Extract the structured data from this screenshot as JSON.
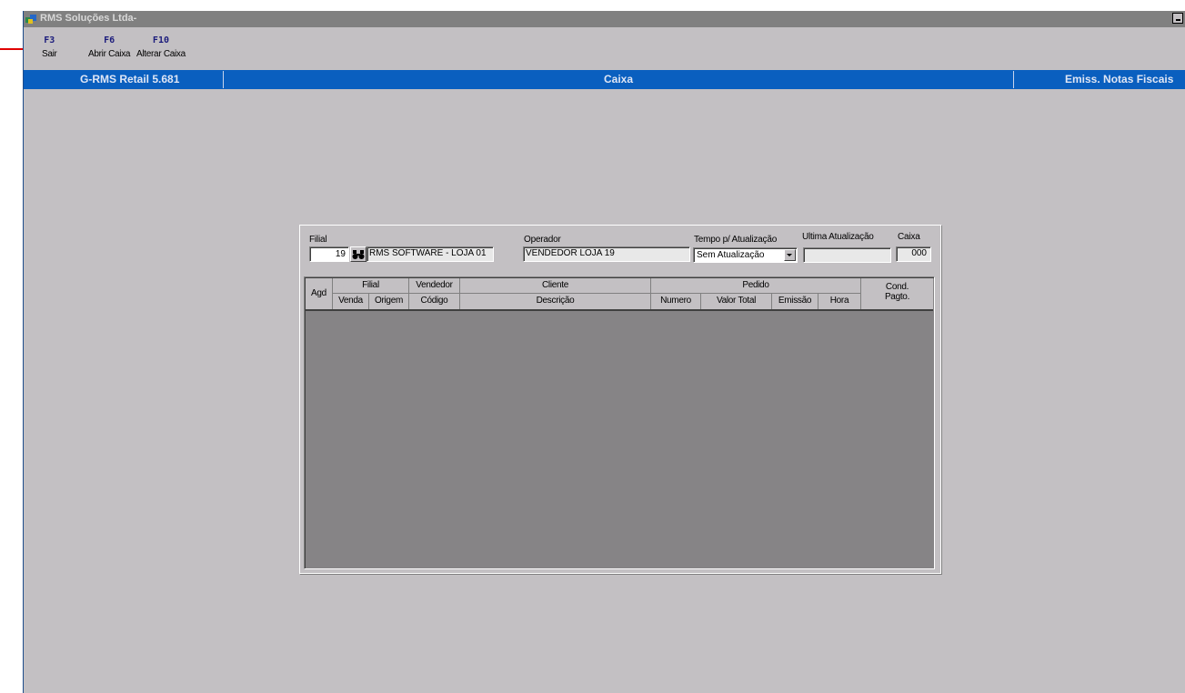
{
  "window": {
    "title": "RMS Soluções Ltda-"
  },
  "fkeys": [
    {
      "key": "F3",
      "label": "Sair"
    },
    {
      "key": "F6",
      "label": "Abrir Caixa"
    },
    {
      "key": "F10",
      "label": "Alterar Caixa"
    }
  ],
  "bluebar": {
    "left": "G-RMS Retail 5.681",
    "center": "Caixa",
    "right": "Emiss. Notas Fiscais"
  },
  "form": {
    "filial_label": "Filial",
    "filial_code": "19",
    "filial_name": "RMS SOFTWARE - LOJA 01",
    "operador_label": "Operador",
    "operador_value": "VENDEDOR LOJA 19",
    "tempo_label": "Tempo p/ Atualização",
    "tempo_value": "Sem Atualização",
    "ultima_label": "Ultima Atualização",
    "ultima_value": "",
    "caixa_label": "Caixa",
    "caixa_value": "000"
  },
  "grid": {
    "agd": "Agd",
    "filial": "Filial",
    "venda": "Venda",
    "origem": "Origem",
    "vendedor": "Vendedor",
    "codigo": "Código",
    "cliente": "Cliente",
    "descricao": "Descrição",
    "pedido": "Pedido",
    "numero": "Numero",
    "valor_total": "Valor Total",
    "emissao": "Emissão",
    "hora": "Hora",
    "cond": "Cond.",
    "pagto": "Pagto."
  },
  "colors": {
    "titlebar": "#808080",
    "bluebar": "#0a5fbf",
    "background": "#c3c0c3",
    "grid_body": "#868486",
    "arrow": "#e00000"
  }
}
